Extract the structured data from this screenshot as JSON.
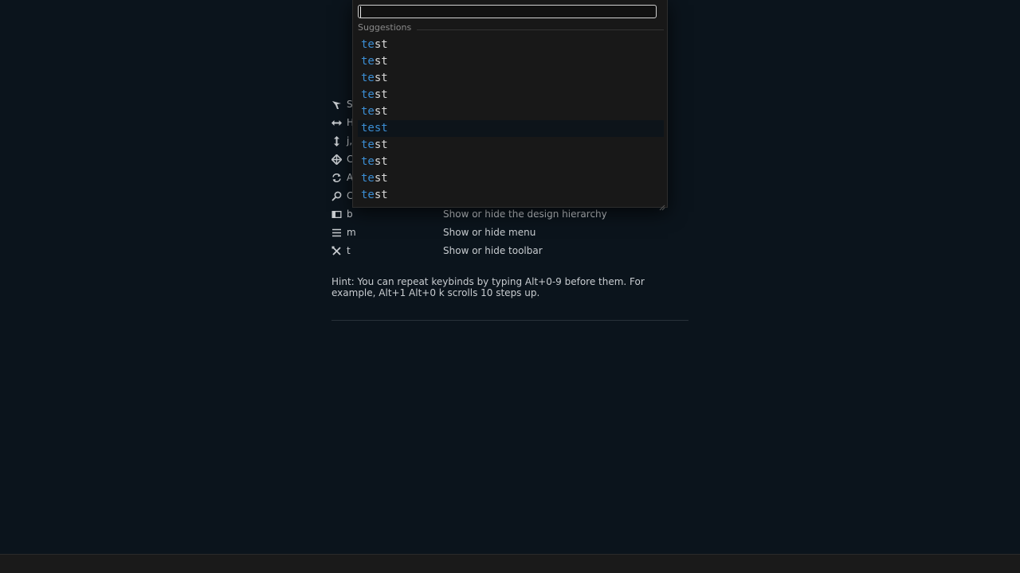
{
  "keybinds": [
    {
      "icon": "select-icon",
      "key": "S",
      "desc": ""
    },
    {
      "icon": "horizontal-arrows-icon",
      "key": "H",
      "desc": ""
    },
    {
      "icon": "vertical-arrows-icon",
      "key": "j,",
      "desc": ""
    },
    {
      "icon": "crosshair-icon",
      "key": "C",
      "desc": ""
    },
    {
      "icon": "refresh-icon",
      "key": "A",
      "desc": ""
    },
    {
      "icon": "search-icon",
      "key": "C",
      "desc": ""
    },
    {
      "icon": "sidebar-icon",
      "key": "b",
      "desc": "Show or hide the design hierarchy"
    },
    {
      "icon": "menu-icon",
      "key": "m",
      "desc": "Show or hide menu"
    },
    {
      "icon": "tools-icon",
      "key": "t",
      "desc": "Show or hide toolbar"
    }
  ],
  "hint": "Hint: You can repeat keybinds by typing Alt+0-9 before them. For example, Alt+1 Alt+0 k scrolls 10 steps up.",
  "popup": {
    "input_value": "",
    "suggestions_label": "Suggestions",
    "suggestions": [
      {
        "match": "te",
        "rest": "st"
      },
      {
        "match": "te",
        "rest": "st"
      },
      {
        "match": "te",
        "rest": "st"
      },
      {
        "match": "te",
        "rest": "st"
      },
      {
        "match": "te",
        "rest": "st"
      },
      {
        "match": "te",
        "rest": "st",
        "selected": true
      },
      {
        "match": "te",
        "rest": "st"
      },
      {
        "match": "te",
        "rest": "st"
      },
      {
        "match": "te",
        "rest": "st"
      },
      {
        "match": "te",
        "rest": "st"
      }
    ]
  },
  "colors": {
    "background": "#0b141c",
    "popup_bg": "#181818",
    "accent": "#3b8ed4",
    "text": "#c8ccd0"
  }
}
